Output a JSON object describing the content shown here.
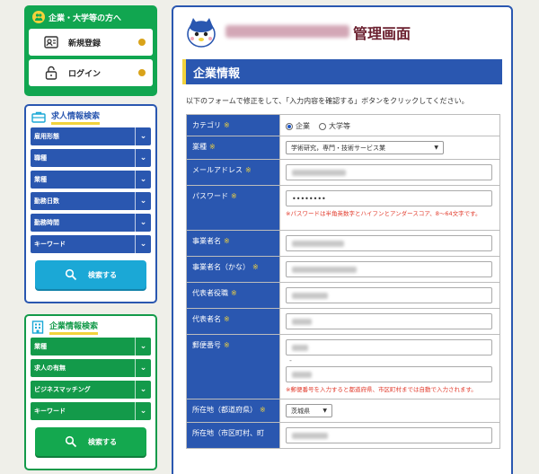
{
  "sidebar_top": {
    "title": "企業・大学等の方へ",
    "buttons": [
      {
        "label": "新規登録",
        "icon": "id-card-icon"
      },
      {
        "label": "ログイン",
        "icon": "lock-icon"
      }
    ]
  },
  "job_search": {
    "title": "求人情報検索",
    "filters": [
      "雇用形態",
      "職種",
      "業種",
      "勤務日数",
      "勤務時間",
      "キーワード"
    ],
    "search_label": "検索する"
  },
  "company_search": {
    "title": "企業情報検索",
    "filters": [
      "業種",
      "求人の有無",
      "ビジネスマッチング",
      "キーワード"
    ],
    "search_label": "検索する"
  },
  "header": {
    "title": "管理画面"
  },
  "section": {
    "title": "企業情報"
  },
  "instruction": "以下のフォームで修正をして、「入力内容を確認する」ボタンをクリックしてください。",
  "form": {
    "required_mark": "※",
    "category": {
      "label": "カテゴリ",
      "options": [
        "企業",
        "大学等"
      ],
      "selected": "企業"
    },
    "industry": {
      "label": "業種",
      "value": "学術研究，専門・技術サービス業"
    },
    "email": {
      "label": "メールアドレス"
    },
    "password": {
      "label": "パスワード",
      "value": "••••••••",
      "hint": "※パスワードは半角英数字とハイフンとアンダースコア、8～64文字です。"
    },
    "business_name": {
      "label": "事業者名"
    },
    "business_name_kana": {
      "label": "事業者名（かな）"
    },
    "rep_title": {
      "label": "代表者役職"
    },
    "rep_name": {
      "label": "代表者名"
    },
    "postal_code": {
      "label": "郵便番号",
      "separator": "-",
      "hint": "※郵便番号を入力すると都道府県、市区町村までは自動で入力されます。"
    },
    "prefecture": {
      "label": "所在地（都道府県）",
      "value": "茨城県"
    },
    "city": {
      "label": "所在地（市区町村、町"
    }
  },
  "colors": {
    "brand_blue": "#2a57b0",
    "brand_green": "#11a650",
    "accent_yellow": "#f2d33c",
    "warning_red": "#e23b2c",
    "header_title": "#6a1f2e"
  }
}
